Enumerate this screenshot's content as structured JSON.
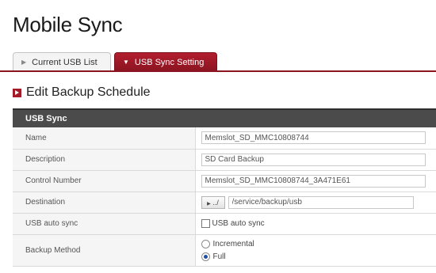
{
  "page": {
    "title": "Mobile Sync"
  },
  "tabs": [
    {
      "label": "Current USB List",
      "active": false
    },
    {
      "label": "USB Sync Setting",
      "active": true
    }
  ],
  "section": {
    "title": "Edit Backup Schedule"
  },
  "panel": {
    "header": "USB Sync"
  },
  "form": {
    "name": {
      "label": "Name",
      "value": "Memslot_SD_MMC10808744"
    },
    "description": {
      "label": "Description",
      "value": "SD Card Backup"
    },
    "control_number": {
      "label": "Control Number",
      "value": "Memslot_SD_MMC10808744_3A471E61"
    },
    "destination": {
      "label": "Destination",
      "browse_label": "../",
      "value": "/service/backup/usb"
    },
    "auto_sync": {
      "label": "USB auto sync",
      "checkbox_label": "USB auto sync",
      "checked": false
    },
    "backup_method": {
      "label": "Backup Method",
      "options": [
        {
          "label": "Incremental",
          "selected": false
        },
        {
          "label": "Full",
          "selected": true
        }
      ]
    }
  },
  "colors": {
    "accent": "#8b1421",
    "header_bg": "#4b4b4b",
    "label_bg": "#f5f5f5"
  }
}
